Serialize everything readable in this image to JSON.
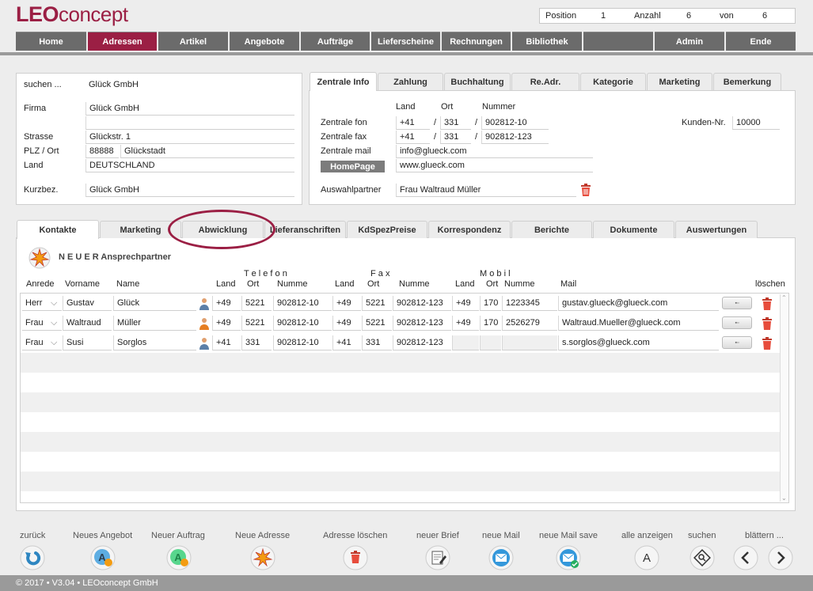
{
  "app": {
    "logo_leo": "LEO",
    "logo_concept": "concept"
  },
  "position": {
    "position_label": "Position",
    "position_value": "1",
    "anzahl_label": "Anzahl",
    "anzahl_value": "6",
    "von_label": "von",
    "von_value": "6"
  },
  "nav": [
    "Home",
    "Adressen",
    "Artikel",
    "Angebote",
    "Aufträge",
    "Lieferscheine",
    "Rechnungen",
    "Bibliothek",
    "",
    "Admin",
    "Ende"
  ],
  "address": {
    "suchen_label": "suchen ...",
    "suchen_value": "Glück GmbH",
    "firma_label": "Firma",
    "firma_value": "Glück GmbH",
    "firma_value2": "",
    "strasse_label": "Strasse",
    "strasse_value": "Glückstr. 1",
    "plz_label": "PLZ / Ort",
    "plz_value": "88888",
    "ort_value": "Glückstadt",
    "land_label": "Land",
    "land_value": "DEUTSCHLAND",
    "kurzbez_label": "Kurzbez.",
    "kurzbez_value": "Glück GmbH"
  },
  "info_tabs": [
    "Zentrale Info",
    "Zahlung",
    "Buchhaltung",
    "Re.Adr.",
    "Kategorie",
    "Marketing",
    "Bemerkung"
  ],
  "info": {
    "col_land": "Land",
    "col_ort": "Ort",
    "col_nummer": "Nummer",
    "fon_label": "Zentrale fon",
    "fon_land": "+41",
    "fon_ort": "331",
    "fon_nummer": "902812-10",
    "fax_label": "Zentrale fax",
    "fax_land": "+41",
    "fax_ort": "331",
    "fax_nummer": "902812-123",
    "mail_label": "Zentrale mail",
    "mail_value": "info@glueck.com",
    "homepage_button": "HomePage",
    "homepage_value": "www.glueck.com",
    "partner_label": "Auswahlpartner",
    "partner_value": "Frau Waltraud Müller",
    "kunden_label": "Kunden-Nr.",
    "kunden_value": "10000",
    "slash": "/"
  },
  "lower_tabs": [
    "Kontakte",
    "Marketing",
    "Abwicklung",
    "Lieferanschriften",
    "KdSpezPreise",
    "Korrespondenz",
    "Berichte",
    "Dokumente",
    "Auswertungen"
  ],
  "contacts": {
    "new_label": "N E U E R  Ansprechpartner",
    "group_telefon": "T e l e f o n",
    "group_fax": "F a x",
    "group_mobil": "M o b i l",
    "headers": {
      "anrede": "Anrede",
      "vorname": "Vorname",
      "name": "Name",
      "land": "Land",
      "ort": "Ort",
      "nummer": "Numme",
      "mail": "Mail",
      "loeschen": "löschen"
    },
    "rows": [
      {
        "anrede": "Herr",
        "vorname": "Gustav",
        "name": "Glück",
        "tel_land": "+49",
        "tel_ort": "5221",
        "tel_nr": "902812-10",
        "fax_land": "+49",
        "fax_ort": "5221",
        "fax_nr": "902812-123",
        "mob_land": "+49",
        "mob_ort": "170",
        "mob_nr": "1223345",
        "mail": "gustav.glueck@glueck.com"
      },
      {
        "anrede": "Frau",
        "vorname": "Waltraud",
        "name": "Müller",
        "tel_land": "+49",
        "tel_ort": "5221",
        "tel_nr": "902812-10",
        "fax_land": "+49",
        "fax_ort": "5221",
        "fax_nr": "902812-123",
        "mob_land": "+49",
        "mob_ort": "170",
        "mob_nr": "2526279",
        "mail": "Waltraud.Mueller@glueck.com"
      },
      {
        "anrede": "Frau",
        "vorname": "Susi",
        "name": "Sorglos",
        "tel_land": "+41",
        "tel_ort": "331",
        "tel_nr": "902812-10",
        "fax_land": "+41",
        "fax_ort": "331",
        "fax_nr": "902812-123",
        "mob_land": "",
        "mob_ort": "",
        "mob_nr": "",
        "mail": "s.sorglos@glueck.com"
      }
    ]
  },
  "toolbar": [
    "zurück",
    "Neues Angebot",
    "Neuer Auftrag",
    "Neue Adresse",
    "Adresse löschen",
    "neuer Brief",
    "neue Mail",
    "neue Mail save",
    "alle anzeigen",
    "suchen",
    "blättern ..."
  ],
  "toolbar_glyphs": {
    "alle": "A"
  },
  "footer": "© 2017 • V3.04 • LEOconcept GmbH",
  "colors": {
    "brand": "#9b1f44",
    "nav": "#6b6b6b"
  }
}
